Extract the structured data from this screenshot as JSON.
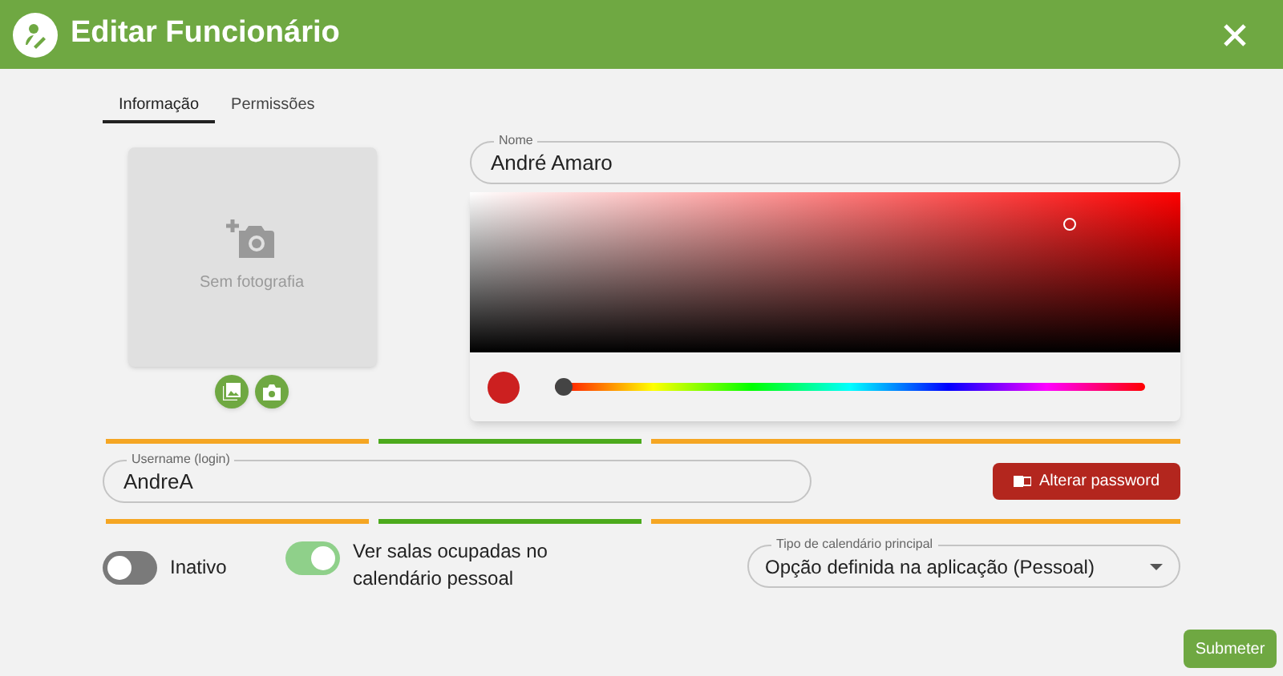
{
  "window": {
    "title": "Editar Funcionário"
  },
  "tabs": [
    {
      "label": "Informação",
      "selected": true
    },
    {
      "label": "Permissões",
      "selected": false
    }
  ],
  "photo": {
    "placeholder": "Sem fotografia"
  },
  "name_field": {
    "label": "Nome",
    "value": "André Amaro"
  },
  "color_picker": {
    "color": "#cc2020",
    "hue_slider": {
      "level": 0
    }
  },
  "username_field": {
    "label": "Username (login)",
    "value": "AndreA"
  },
  "change_password_button": {
    "label": "Alterar password"
  },
  "toggles": [
    {
      "label": "Inativo",
      "on": false
    },
    {
      "label": "Ver salas ocupadas no calendário pessoal",
      "on": true
    }
  ],
  "calendar_select": {
    "label": "Tipo de calendário principal",
    "value": "Opção definida na aplicação (Pessoal)"
  },
  "submit_button": {
    "label": "Submeter"
  }
}
